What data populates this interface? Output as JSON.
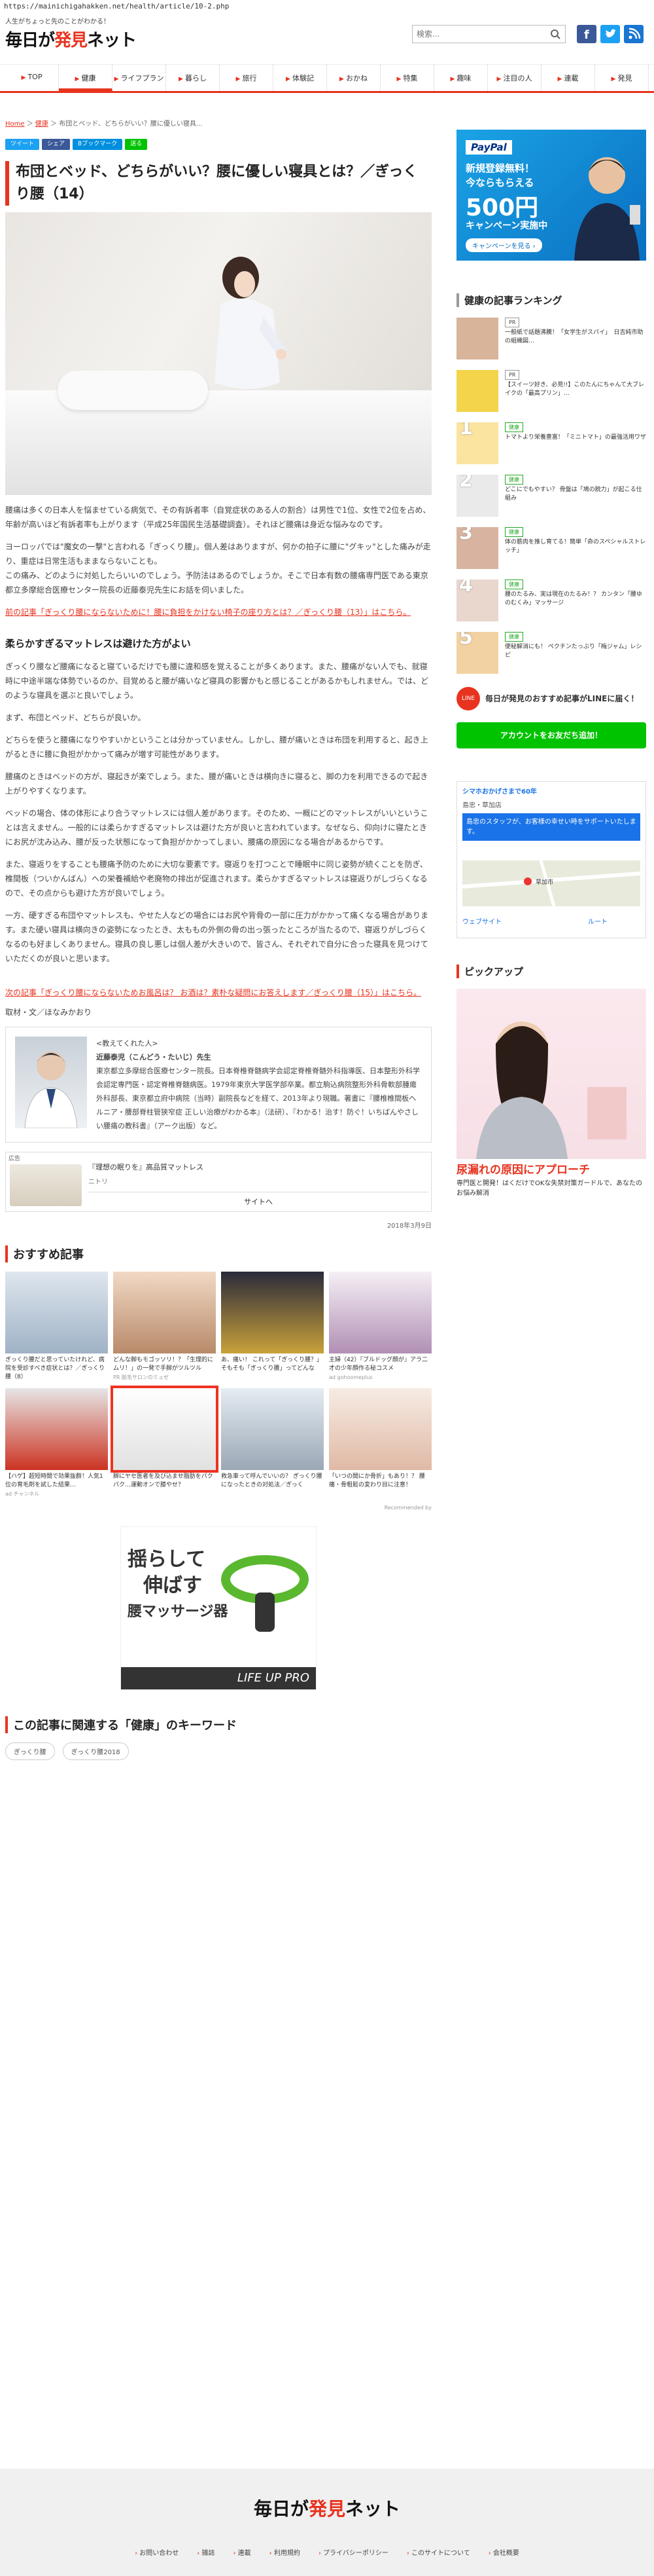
{
  "url": "https://mainichigahakken.net/health/article/10-2.php",
  "tagline": "人生がちょっと先のことがわかる！",
  "logo": {
    "text_a": "毎日が",
    "text_b": "発見",
    "text_c": "ネット"
  },
  "search": {
    "placeholder": "検索..."
  },
  "nav": [
    "TOP",
    "健康",
    "ライフプラン",
    "暮らし",
    "旅行",
    "体験記",
    "おかね",
    "特集",
    "趣味",
    "注目の人",
    "連載",
    "発見"
  ],
  "breadcrumb": {
    "home": "Home",
    "sep": " ＞ ",
    "cat": "健康",
    "current": "布団とベッド、どちらがいい？腰に優しい寝具..."
  },
  "share": [
    "ツイート",
    "シェア",
    "Bブックマーク",
    "送る"
  ],
  "article": {
    "title": "布団とベッド、どちらがいい？腰に優しい寝具とは？／ぎっくり腰（14）",
    "p1": "腰痛は多くの日本人を悩ませている病気で、その有訴者率（自覚症状のある人の割合）は男性で1位、女性で2位を占め、年齢が高いほど有訴者率も上がります（平成25年国民生活基礎調査）。それほど腰痛は身近な悩みなのです。",
    "p2": "ヨーロッパでは\"魔女の一撃\"と言われる「ぎっくり腰」。個人差はありますが、何かの拍子に腰に\"グキッ\"とした痛みが走り、重症は日常生活もままならないことも。",
    "p3": "この痛み、どのように対処したらいいのでしょう。予防法はあるのでしょうか。そこで日本有数の腰痛専門医である東京都立多摩総合医療センター院長の近藤泰児先生にお話を伺いました。",
    "link_prev": "前の記事「ぎっくり腰にならないために！腰に負担をかけない椅子の座り方とは？／ぎっくり腰（13）」はこちら。",
    "h1": "柔らかすぎるマットレスは避けた方がよい",
    "p4": "ぎっくり腰など腰痛になると寝ているだけでも腰に違和感を覚えることが多くあります。また、腰痛がない人でも、就寝時に中途半端な体勢でいるのか、目覚めると腰が痛いなど寝具の影響かもと感じることがあるかもしれません。では、どのような寝具を選ぶと良いでしょう。",
    "p5": "まず、布団とベッド、どちらが良いか。",
    "p6": "どちらを使うと腰痛になりやすいかということは分かっていません。しかし、腰が痛いときは布団を利用すると、起き上がるときに腰に負担がかかって痛みが増す可能性があります。",
    "p7": "腰痛のときはベッドの方が、寝起きが楽でしょう。また、腰が痛いときは横向きに寝ると、脚の力を利用できるので起き上がりやすくなります。",
    "p8": "ベッドの場合、体の体形により合うマットレスには個人差があります。そのため、一概にどのマットレスがいいということは言えません。一般的には柔らかすぎるマットレスは避けた方が良いと言われています。なぜなら、仰向けに寝たときにお尻が沈み込み、腰が反った状態になって負担がかかってしまい、腰痛の原因になる場合があるからです。",
    "p9": "また、寝返りをすることも腰痛予防のために大切な要素です。寝返りを打つことで睡眠中に同じ姿勢が続くことを防ぎ、椎間板（ついかんばん）への栄養補給や老廃物の排出が促進されます。柔らかすぎるマットレスは寝返りがしづらくなるので、その点からも避けた方が良いでしょう。",
    "p10": "一方、硬すぎる布団やマットレスも、やせた人などの場合にはお尻や背骨の一部に圧力がかかって痛くなる場合があります。また硬い寝具は横向きの姿勢になったとき、太ももの外側の骨の出っ張ったところが当たるので、寝返りがしづらくなるのも好ましくありません。寝具の良し悪しは個人差が大きいので、皆さん、それぞれで自分に合った寝具を見つけていただくのが良いと思います。",
    "link_next": "次の記事「ぎっくり腰にならないためお風呂は？ お酒は？素朴な疑問にお答えします／ぎっくり腰（15）」はこちら。",
    "credit": "取材・文／ほなみかおり",
    "prof_head": "<教えてくれた人>",
    "prof_name": "近藤泰児（こんどう・たいじ）先生",
    "prof_body": "東京都立多摩総合医療センター院長。日本脊椎脊髄病学会認定脊椎脊髄外科指導医、日本整形外科学会認定専門医・認定脊椎脊髄病医。1979年東京大学医学部卒業。都立駒込病院整形外科骨軟部腫瘍外科部長、東京都立府中病院（当時）副院長などを経て、2013年より現職。著書に『腰椎椎間板ヘルニア・腰部脊柱管狭窄症 正しい治療がわかる本』（法研）、『わかる！治す！防ぐ！いちばんやさしい腰痛の教科書』（アーク出版）など。",
    "date": "2018年3月9日"
  },
  "ad": {
    "label": "広告",
    "title": "『理想の眠りを』高品質マットレス",
    "sub": "ニトリ",
    "btn": "サイトへ"
  },
  "recommend": {
    "title": "おすすめ記事",
    "items": [
      {
        "text": "ぎっくり腰だと思っていたけれど、病院を受診すべき症状とは？／ぎっくり腰（8）",
        "src": ""
      },
      {
        "text": "どんな脚もモゴッソリ！？「生理的にムリ！」の一発で手脚がツルツル",
        "src": "PR 脱毛サロンのミュゼ"
      },
      {
        "text": "あ、痛い！ これって「ぎっくり腰？」 そもそも「ぎっくり腰」ってどんな",
        "src": ""
      },
      {
        "text": "主婦（42）『ブルドッグ顔が』アラ二才の少年顔作る秘コスメ",
        "src": "ad gohoomeplus"
      },
      {
        "text": "【ハゲ】超短時間で効果抜群！人気1位の育毛剤を試した結果…",
        "src": "ad チャンネル"
      },
      {
        "text": "脚にヤセ医者を及び込ませ脂肪をパクパク…運動オンで膝やせ？",
        "src": ""
      },
      {
        "text": "救急車って呼んでいいの？ ぎっくり腰になったときの対処法／ぎっく",
        "src": ""
      },
      {
        "text": "「いつの間にか骨折」もあり！？ 腰痛・骨粗鬆の変わり目に注意！",
        "src": ""
      }
    ],
    "by": "Recommended by"
  },
  "keywords": {
    "title": "この記事に関連する「健康」のキーワード",
    "items": [
      "ぎっくり腰",
      "ぎっくり腰2018"
    ]
  },
  "sidebar": {
    "paypal": {
      "brand": "PayPal",
      "line1": "新規登録無料！",
      "line2": "今ならもらえる",
      "amount": "500円",
      "line3": "キャンペーン実施中",
      "btn": "キャンペーンを見る ›"
    },
    "ranking_title": "健康の記事ランキング",
    "ranking": [
      {
        "tag": "PR",
        "text": "一般紙で話題沸騰！「女学生がスパイ」　日吉純市助の組織図…",
        "num": ""
      },
      {
        "tag": "PR",
        "text": "【スイーツ好き、必見!!】このたんにちゃんて大ブレイクの「最高プリン」…",
        "num": ""
      },
      {
        "tag": "健康",
        "text": "トマトより栄養豊富！「ミニトマト」の最強活用ワザ",
        "num": "1"
      },
      {
        "tag": "健康",
        "text": "どこにでもやすい？ 骨盤は「鳩の脱力」が起こる仕組み",
        "num": "2"
      },
      {
        "tag": "健康",
        "text": "体の筋肉を推し育てる！簡単「命のスペシャルストレッチ」",
        "num": "3"
      },
      {
        "tag": "健康",
        "text": "腰のたるみ、実は現在のたるみ！？ カンタン「腰ゆのむくみ」マッサージ",
        "num": "4"
      },
      {
        "tag": "健康",
        "text": "便秘解消にも！ ぺクチンたっぷり「梅ジャム」レシピ",
        "num": "5"
      }
    ],
    "line": {
      "icon": "LINE",
      "text": "毎日が発見のおすすめ記事がLINEに届く！",
      "btn": "アカウントをお友だち追加！"
    },
    "map": {
      "head": "シマホおかげさまで60年",
      "sub": "島忠・草加店",
      "body": "島忠のスタッフが、お客様の幸せい時をサポートいたします。",
      "pin": "草加市",
      "site": "ウェブサイト",
      "route": "ルート"
    },
    "pickup_title": "ピックアップ",
    "pickup": {
      "caption": "尿漏れの原因にアプローチ",
      "sub": "専門医と開発！はくだけでOKな失禁対策ガードルで、あなたのお悩み解消"
    }
  },
  "bigad": {
    "a": "揺らして",
    "b": "伸ばす",
    "c": "腰マッサージ器",
    "d": "LIFE UP PRO"
  },
  "footer": {
    "links": [
      "お問い合わせ",
      "雑誌",
      "連載",
      "利用規約",
      "プライバシーポリシー",
      "このサイトについて",
      "会社概要"
    ]
  }
}
